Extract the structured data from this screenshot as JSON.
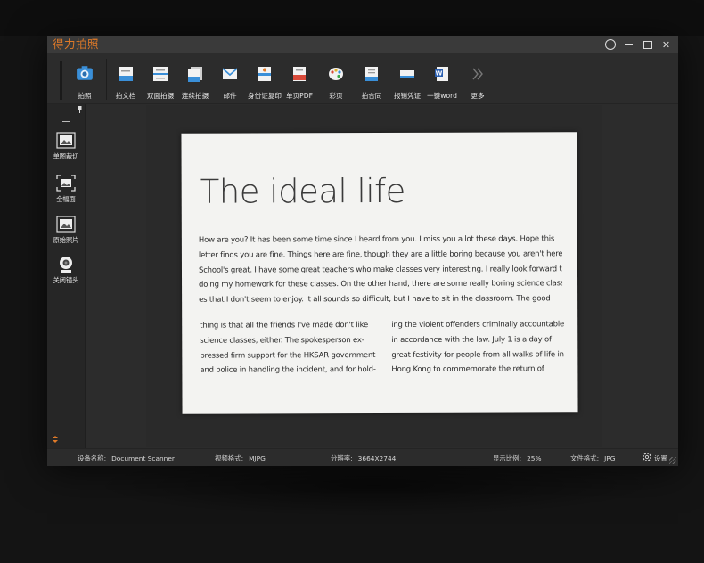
{
  "app": {
    "title": "得力拍照"
  },
  "toolbar": {
    "items": [
      {
        "label": "拍照",
        "icon": "camera-icon"
      },
      {
        "label": "拍文档",
        "icon": "document-scan-icon"
      },
      {
        "label": "双面拍摄",
        "icon": "double-side-icon"
      },
      {
        "label": "连续拍摄",
        "icon": "continuous-shoot-icon"
      },
      {
        "label": "邮件",
        "icon": "mail-icon"
      },
      {
        "label": "身份证复印",
        "icon": "id-card-icon"
      },
      {
        "label": "单页PDF",
        "icon": "pdf-icon"
      },
      {
        "label": "彩页",
        "icon": "palette-icon"
      },
      {
        "label": "拍合同",
        "icon": "contract-icon"
      },
      {
        "label": "报销凭证",
        "icon": "receipt-icon"
      },
      {
        "label": "一键word",
        "icon": "word-icon"
      },
      {
        "label": "更多",
        "icon": "more-chevron-icon"
      }
    ]
  },
  "sidebar": {
    "items": [
      {
        "label": "单图裁切",
        "icon": "single-crop-icon"
      },
      {
        "label": "全幅面",
        "icon": "full-frame-icon"
      },
      {
        "label": "原始照片",
        "icon": "original-photo-icon"
      },
      {
        "label": "关闭镜头",
        "icon": "webcam-icon"
      }
    ]
  },
  "document": {
    "title": "The ideal life",
    "paragraph_lines": [
      "How are you? It has been some time since I heard from you. I miss you a lot these days. Hope this",
      "letter finds you are fine. Things here are fine, though they are a little boring because you aren't here.",
      "School's great. I have some great teachers who make classes very interesting. I really look forward to",
      "doing my homework for these classes. On the other hand, there are some really boring science class-",
      "es that I don't seem to enjoy. It all sounds so difficult, but I have to sit in the classroom. The good"
    ],
    "left_column_lines": [
      "thing is that all the friends I've made don't like",
      "science classes, either. The spokesperson ex-",
      "pressed firm support for the HKSAR government",
      "and police in handling the incident, and for hold-"
    ],
    "right_column_lines": [
      "ing the violent offenders criminally accountable",
      "in accordance with the law. July 1 is a day of",
      "great festivity for people from all walks of life in",
      "Hong Kong to commemorate the return of"
    ]
  },
  "status": {
    "device_label": "设备名称:",
    "device_value": "Document Scanner",
    "video_label": "视频格式:",
    "video_value": "MJPG",
    "resolution_label": "分辨率:",
    "resolution_value": "3664X2744",
    "zoom_label": "显示比例:",
    "zoom_value": "25%",
    "format_label": "文件格式:",
    "format_value": "JPG",
    "settings_label": "设置"
  },
  "colors": {
    "accent": "#e07a28",
    "icon_blue": "#3a8fd8",
    "window_bg": "#2c2c2c"
  }
}
